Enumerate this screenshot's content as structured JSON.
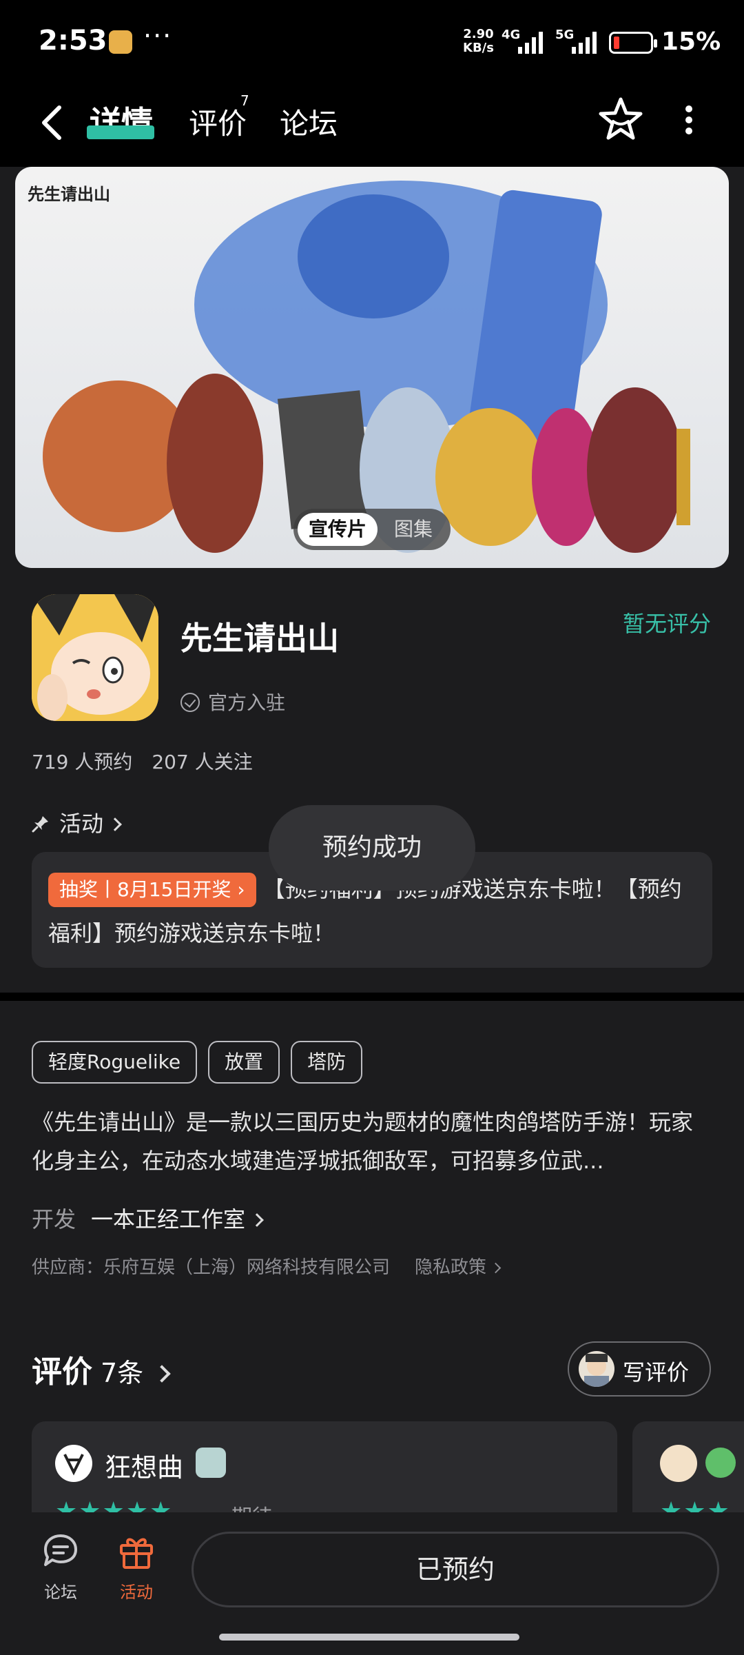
{
  "status_bar": {
    "time": "2:53",
    "dots": "···",
    "speed_value": "2.90",
    "speed_unit": "KB/s",
    "net1": "4G",
    "net2": "5G",
    "battery_pct": "15%",
    "battery_level": 0.15
  },
  "nav": {
    "tabs": [
      "详情",
      "评价",
      "论坛"
    ],
    "review_badge": "7",
    "icons": {
      "back": "back-arrow-icon",
      "favorite": "star-icon",
      "more": "more-vertical-icon"
    }
  },
  "banner": {
    "logo": "先生请出山",
    "media_options": [
      "宣传片",
      "图集"
    ]
  },
  "app": {
    "name": "先生请出山",
    "verified": "官方入驻",
    "rating": "暂无评分",
    "reservations": "719 人预约",
    "followers": "207 人关注"
  },
  "activity": {
    "label": "活动",
    "lottery_tag": "抽奖丨8月15日开奖",
    "text": "【预约福利】预约游戏送京东卡啦！【预约福利】预约游戏送京东卡啦！"
  },
  "toast": "预约成功",
  "tags": [
    "轻度Roguelike",
    "放置",
    "塔防"
  ],
  "description": "《先生请出山》是一款以三国历史为题材的魔性肉鸽塔防手游！玩家化身主公，在动态水域建造浮城抵御敌军，可招募多位武...",
  "developer": {
    "label": "开发",
    "name": "一本正经工作室"
  },
  "supplier": {
    "text": "供应商：乐府互娱（上海）网络科技有限公司",
    "privacy": "隐私政策"
  },
  "reviews": {
    "title": "评价",
    "count": "7条",
    "write": "写评价",
    "items": [
      {
        "user": "狂想曲",
        "stars": "★★★★★",
        "tag": "期待"
      }
    ],
    "preview_stars": "★★★"
  },
  "bottom": {
    "forum": "论坛",
    "activity": "活动",
    "reserved": "已预约"
  },
  "colors": {
    "accent": "#2fbfa4",
    "orange": "#f06a3c",
    "background": "#1c1c1e"
  }
}
